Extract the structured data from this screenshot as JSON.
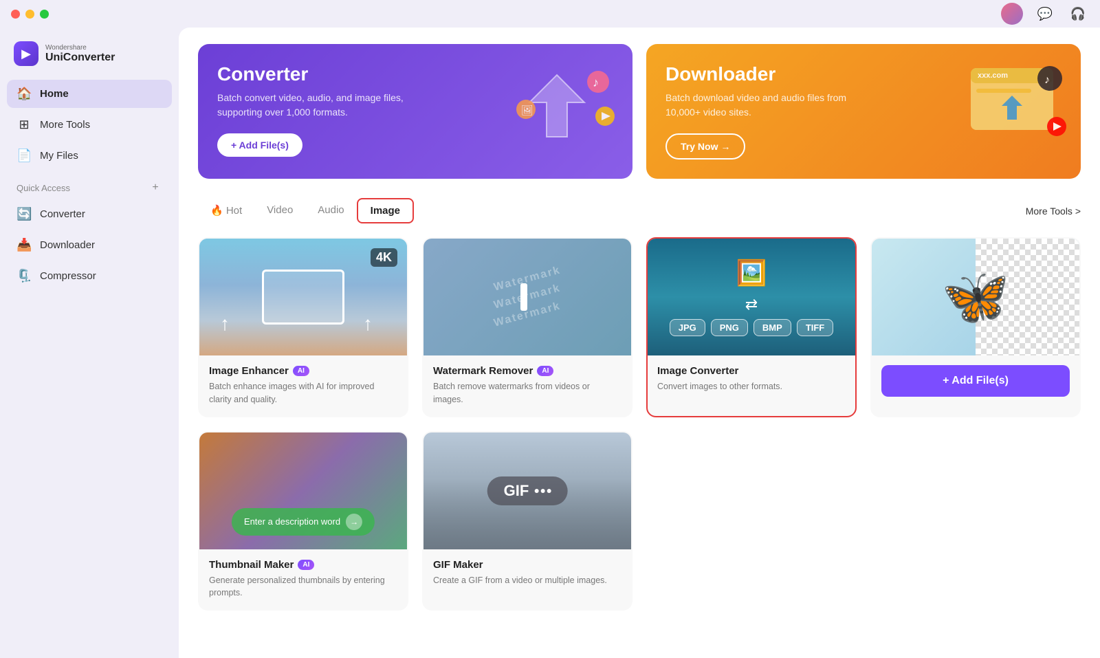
{
  "titlebar": {
    "traffic_lights": [
      "red",
      "yellow",
      "green"
    ]
  },
  "app": {
    "brand_top": "Wondershare",
    "brand_bottom": "UniConverter"
  },
  "sidebar": {
    "nav_items": [
      {
        "id": "home",
        "label": "Home",
        "icon": "🏠",
        "active": true
      },
      {
        "id": "more-tools",
        "label": "More Tools",
        "icon": "⊞"
      },
      {
        "id": "my-files",
        "label": "My Files",
        "icon": "📄"
      }
    ],
    "quick_access_label": "Quick Access",
    "quick_access_items": [
      {
        "id": "converter",
        "label": "Converter",
        "icon": "🔄"
      },
      {
        "id": "downloader",
        "label": "Downloader",
        "icon": "📥"
      },
      {
        "id": "compressor",
        "label": "Compressor",
        "icon": "🗜️"
      }
    ]
  },
  "banners": [
    {
      "id": "converter",
      "title": "Converter",
      "desc": "Batch convert video, audio, and image files, supporting over 1,000 formats.",
      "btn_label": "+ Add File(s)",
      "style": "purple"
    },
    {
      "id": "downloader",
      "title": "Downloader",
      "desc": "Batch download video and audio files from 10,000+ video sites.",
      "btn_label": "Try Now →",
      "style": "orange"
    }
  ],
  "tabs": {
    "items": [
      {
        "id": "hot",
        "label": "🔥 Hot"
      },
      {
        "id": "video",
        "label": "Video"
      },
      {
        "id": "audio",
        "label": "Audio"
      },
      {
        "id": "image",
        "label": "Image",
        "active": true
      }
    ],
    "more_tools_link": "More Tools >"
  },
  "tools": [
    {
      "id": "image-enhancer",
      "title": "Image Enhancer",
      "ai": true,
      "desc": "Batch enhance images with AI for improved clarity and quality.",
      "thumb_type": "enhancer",
      "resolution": "4K",
      "selected": false
    },
    {
      "id": "watermark-remover",
      "title": "Watermark Remover",
      "ai": true,
      "desc": "Batch remove watermarks from videos or images.",
      "thumb_type": "watermark",
      "selected": false
    },
    {
      "id": "image-converter",
      "title": "Image Converter",
      "ai": false,
      "desc": "Convert images to other formats.",
      "thumb_type": "converter",
      "formats": [
        "JPG",
        "PNG",
        "BMP",
        "TIFF"
      ],
      "selected": true
    },
    {
      "id": "bg-remover",
      "title": "",
      "ai": false,
      "desc": "",
      "thumb_type": "add-files",
      "add_files_label": "+ Add File(s)",
      "selected": false
    },
    {
      "id": "thumbnail-maker",
      "title": "Thumbnail Maker",
      "ai": true,
      "desc": "Generate personalized thumbnails by entering prompts.",
      "thumb_type": "thumbnail",
      "prompt_placeholder": "Enter a description word",
      "selected": false
    },
    {
      "id": "gif-maker",
      "title": "GIF Maker",
      "ai": false,
      "desc": "Create a GIF from a video or multiple images.",
      "thumb_type": "gif",
      "selected": false
    }
  ]
}
